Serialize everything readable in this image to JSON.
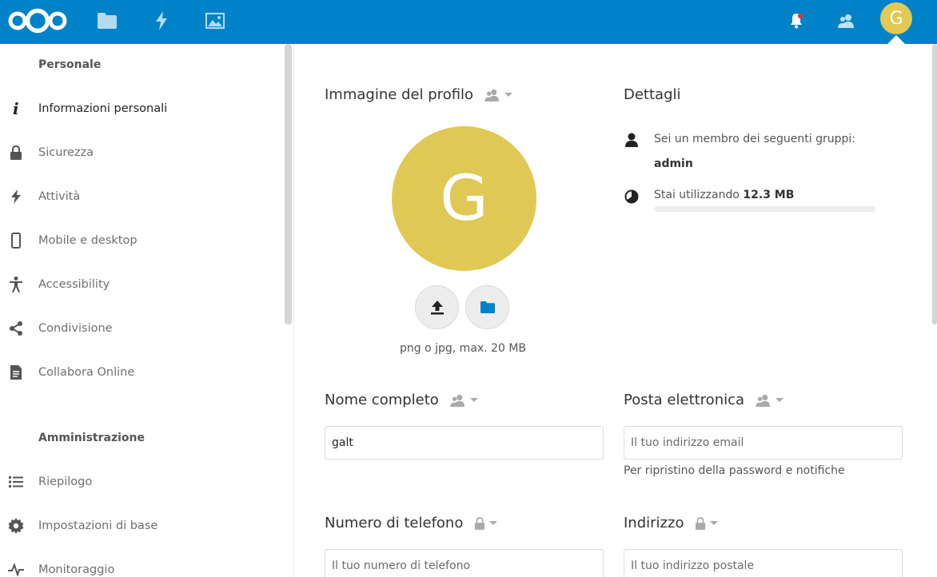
{
  "header": {
    "apps": [
      "files-icon",
      "activity-icon",
      "gallery-icon"
    ],
    "right_icons": [
      "notifications-icon",
      "contacts-icon"
    ],
    "user_initial": "G",
    "brand_color": "#0082c9"
  },
  "sidebar": {
    "personal_heading": "Personale",
    "personal_items": [
      {
        "label": "Informazioni personali",
        "icon": "info-icon",
        "active": true
      },
      {
        "label": "Sicurezza",
        "icon": "lock-icon"
      },
      {
        "label": "Attività",
        "icon": "activity-icon"
      },
      {
        "label": "Mobile e desktop",
        "icon": "phone-icon"
      },
      {
        "label": "Accessibility",
        "icon": "accessibility-icon"
      },
      {
        "label": "Condivisione",
        "icon": "share-icon"
      },
      {
        "label": "Collabora Online",
        "icon": "document-icon"
      }
    ],
    "admin_heading": "Amministrazione",
    "admin_items": [
      {
        "label": "Riepilogo",
        "icon": "list-icon"
      },
      {
        "label": "Impostazioni di base",
        "icon": "gear-icon"
      },
      {
        "label": "Monitoraggio",
        "icon": "pulse-icon"
      }
    ]
  },
  "profile": {
    "heading": "Immagine del profilo",
    "avatar_initial": "G",
    "avatar_color": "#dfc954",
    "upload_hint": "png o jpg, max. 20 MB"
  },
  "details": {
    "heading": "Dettagli",
    "groups_text": "Sei un membro dei seguenti gruppi:",
    "groups_value": "admin",
    "usage_prefix": "Stai utilizzando",
    "usage_value": "12.3 MB",
    "usage_fraction": 0.0
  },
  "form": {
    "full_name": {
      "label": "Nome completo",
      "value": "galt"
    },
    "email": {
      "label": "Posta elettronica",
      "placeholder": "Il tuo indirizzo email",
      "hint": "Per ripristino della password e notifiche"
    },
    "phone": {
      "label": "Numero di telefono",
      "placeholder": "Il tuo numero di telefono"
    },
    "address": {
      "label": "Indirizzo",
      "placeholder": "Il tuo indirizzo postale"
    }
  }
}
